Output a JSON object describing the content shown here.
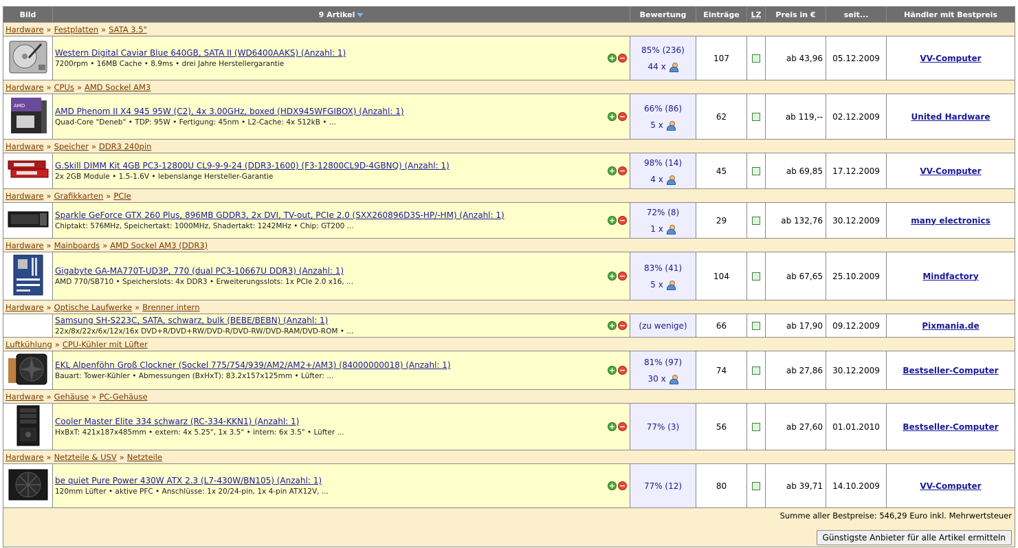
{
  "header": {
    "image": "Bild",
    "articles": "9 Artikel",
    "rating": "Bewertung",
    "entries": "Einträge",
    "lz": "LZ",
    "price": "Preis in €",
    "since": "seit...",
    "dealer": "Händler mit Bestpreis"
  },
  "rows": [
    {
      "cat": [
        "Hardware",
        "Festplatten",
        "SATA 3.5\""
      ],
      "name": "Western Digital Caviar Blue 640GB, SATA II (WD6400AAKS) (Anzahl: 1)",
      "spec": "7200rpm • 16MB Cache • 8.9ms • drei Jahre Herstellergarantie",
      "rating": "85% (236)",
      "reviews": "44 x",
      "entries": "107",
      "price": "ab 43,96",
      "since": "05.12.2009",
      "dealer": "VV-Computer",
      "thumb": "hdd-icon"
    },
    {
      "cat": [
        "Hardware",
        "CPUs",
        "AMD Sockel AM3"
      ],
      "name": "AMD Phenom II X4 945 95W (C2), 4x 3.00GHz, boxed (HDX945WFGIBOX) (Anzahl: 1)",
      "spec": "Quad-Core \"Deneb\" • TDP: 95W • Fertigung: 45nm • L2-Cache: 4x 512kB • ...",
      "rating": "66% (86)",
      "reviews": "5 x",
      "entries": "62",
      "price": "ab 119,--",
      "since": "02.12.2009",
      "dealer": "United Hardware",
      "thumb": "cpu-box-icon"
    },
    {
      "cat": [
        "Hardware",
        "Speicher",
        "DDR3 240pin"
      ],
      "name": "G.Skill DIMM Kit 4GB PC3-12800U CL9-9-9-24 (DDR3-1600) (F3-12800CL9D-4GBNQ) (Anzahl: 1)",
      "spec": "2x 2GB Module • 1.5-1.6V • lebenslange Hersteller-Garantie",
      "rating": "98% (14)",
      "reviews": "4 x",
      "entries": "45",
      "price": "ab 69,85",
      "since": "17.12.2009",
      "dealer": "VV-Computer",
      "thumb": "ram-icon"
    },
    {
      "cat": [
        "Hardware",
        "Grafikkarten",
        "PCIe"
      ],
      "name": "Sparkle GeForce GTX 260 Plus, 896MB GDDR3, 2x DVI, TV-out, PCIe 2.0 (SXX260896D3S-HP/-HM) (Anzahl: 1)",
      "spec": "Chiptakt: 576MHz, Speichertakt: 1000MHz, Shadertakt: 1242MHz • Chip: GT200 ...",
      "rating": "72% (8)",
      "reviews": "1 x",
      "entries": "29",
      "price": "ab 132,76",
      "since": "30.12.2009",
      "dealer": "many electronics",
      "thumb": "gpu-icon"
    },
    {
      "cat": [
        "Hardware",
        "Mainboards",
        "AMD Sockel AM3 (DDR3)"
      ],
      "name": "Gigabyte GA-MA770T-UD3P, 770 (dual PC3-10667U DDR3) (Anzahl: 1)",
      "spec": "AMD 770/SB710 • Speicherslots: 4x DDR3 • Erweiterungsslots: 1x PCIe 2.0 x16, ...",
      "rating": "83% (41)",
      "reviews": "5 x",
      "entries": "104",
      "price": "ab 67,65",
      "since": "25.10.2009",
      "dealer": "Mindfactory",
      "thumb": "mainboard-icon"
    },
    {
      "cat": [
        "Hardware",
        "Optische Laufwerke",
        "Brenner intern"
      ],
      "name": "Samsung SH-S223C, SATA, schwarz, bulk (BEBE/BEBN) (Anzahl: 1)",
      "spec": "22x/8x/22x/6x/12x/16x DVD+R/DVD+RW/DVD-R/DVD-RW/DVD-RAM/DVD-ROM • ...",
      "rating": "(zu wenige)",
      "reviews": "",
      "entries": "66",
      "price": "ab 17,90",
      "since": "09.12.2009",
      "dealer": "Pixmania.de",
      "thumb": ""
    },
    {
      "cat": [
        "Luftkühlung",
        "CPU-Kühler mit Lüfter"
      ],
      "name": "EKL Alpenföhn Groß Clockner (Sockel 775/754/939/AM2/AM2+/AM3) (84000000018) (Anzahl: 1)",
      "spec": "Bauart: Tower-Kühler • Abmessungen (BxHxT): 83.2x157x125mm • Lüfter: ...",
      "rating": "81% (97)",
      "reviews": "30 x",
      "entries": "74",
      "price": "ab 27,86",
      "since": "30.12.2009",
      "dealer": "Bestseller-Computer",
      "thumb": "cooler-icon"
    },
    {
      "cat": [
        "Hardware",
        "Gehäuse",
        "PC-Gehäuse"
      ],
      "name": "Cooler Master Elite 334 schwarz (RC-334-KKN1) (Anzahl: 1)",
      "spec": "HxBxT: 421x187x485mm • extern: 4x 5.25\", 1x 3.5\" • intern: 6x 3.5\" • Lüfter ...",
      "rating": "77% (3)",
      "reviews": "",
      "entries": "56",
      "price": "ab 27,60",
      "since": "01.01.2010",
      "dealer": "Bestseller-Computer",
      "thumb": "case-icon"
    },
    {
      "cat": [
        "Hardware",
        "Netzteile & USV",
        "Netzteile"
      ],
      "name": "be quiet Pure Power 430W ATX 2.3 (L7-430W/BN105) (Anzahl: 1)",
      "spec": "120mm Lüfter • aktive PFC • Anschlüsse: 1x 20/24-pin, 1x 4-pin ATX12V, ...",
      "rating": "77% (12)",
      "reviews": "",
      "entries": "80",
      "price": "ab 39,71",
      "since": "14.10.2009",
      "dealer": "VV-Computer",
      "thumb": "psu-icon"
    }
  ],
  "footer": {
    "sum": "Summe aller Bestpreise: 546,29 Euro inkl. Mehrwertsteuer",
    "button": "Günstigste Anbieter für alle Artikel ermitteln"
  },
  "row_heights": [
    64,
    66,
    52,
    52,
    70,
    34,
    52,
    68,
    64
  ]
}
